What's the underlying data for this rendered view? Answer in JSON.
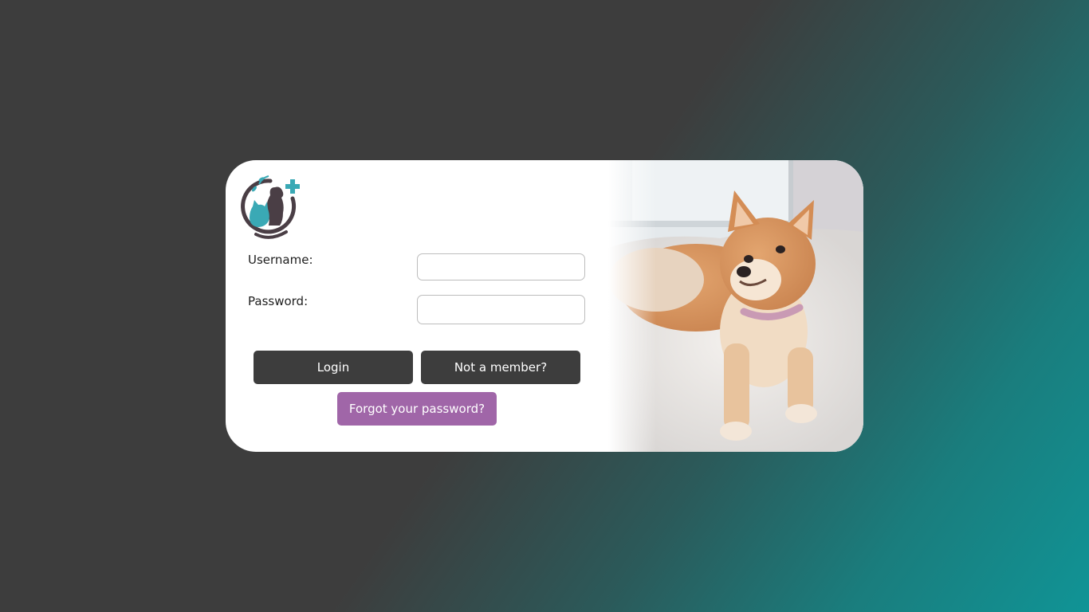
{
  "form": {
    "username_label": "Username:",
    "username_value": "",
    "password_label": "Password:",
    "password_value": ""
  },
  "buttons": {
    "login": "Login",
    "not_member": "Not a member?",
    "forgot_password": "Forgot your password?"
  },
  "icons": {
    "logo": "pet-clinic-logo-icon",
    "photo": "puppy-photo"
  },
  "colors": {
    "dark_button": "#3d3d3d",
    "accent_button": "#a066a8",
    "logo_teal": "#3aa9b5",
    "logo_dark": "#4a3e45"
  }
}
